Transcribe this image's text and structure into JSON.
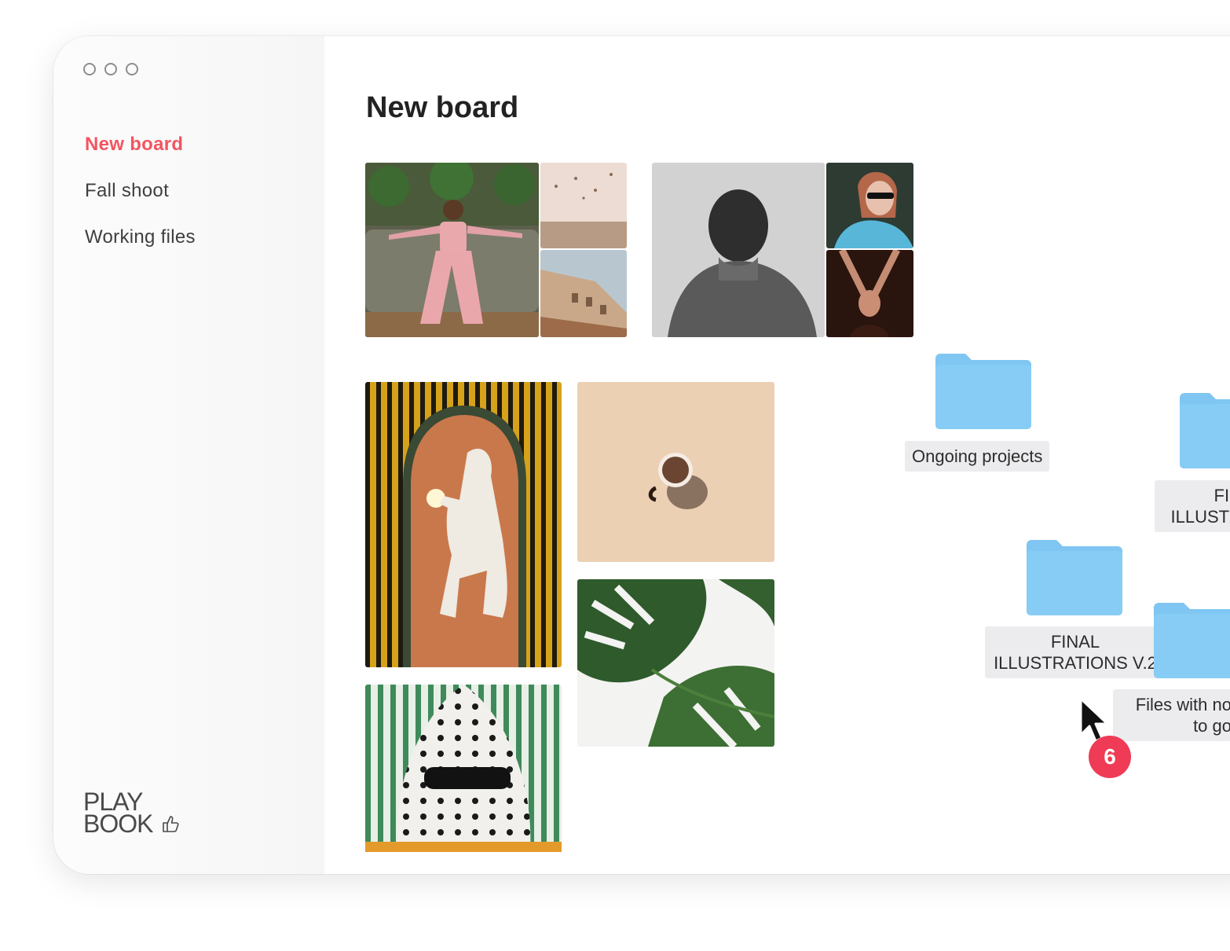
{
  "sidebar": {
    "nav": [
      "New board",
      "Fall shoot",
      "Working files"
    ],
    "logo": {
      "line1": "PLAY",
      "line2": "BOOK"
    }
  },
  "main": {
    "title": "New board"
  },
  "folders": [
    {
      "label": "Ongoing projects"
    },
    {
      "label_line1": "FIN",
      "label_line2": "ILLUSTR"
    },
    {
      "label_line1": "FINAL",
      "label_line2": "ILLUSTRATIONS V.2"
    },
    {
      "label_line1": "Files with no",
      "label_line2": "to go"
    }
  ],
  "drag": {
    "count": "6"
  },
  "colors": {
    "accent": "#f25561",
    "folder": "#7fc6f2",
    "badge": "#ef3b55"
  }
}
